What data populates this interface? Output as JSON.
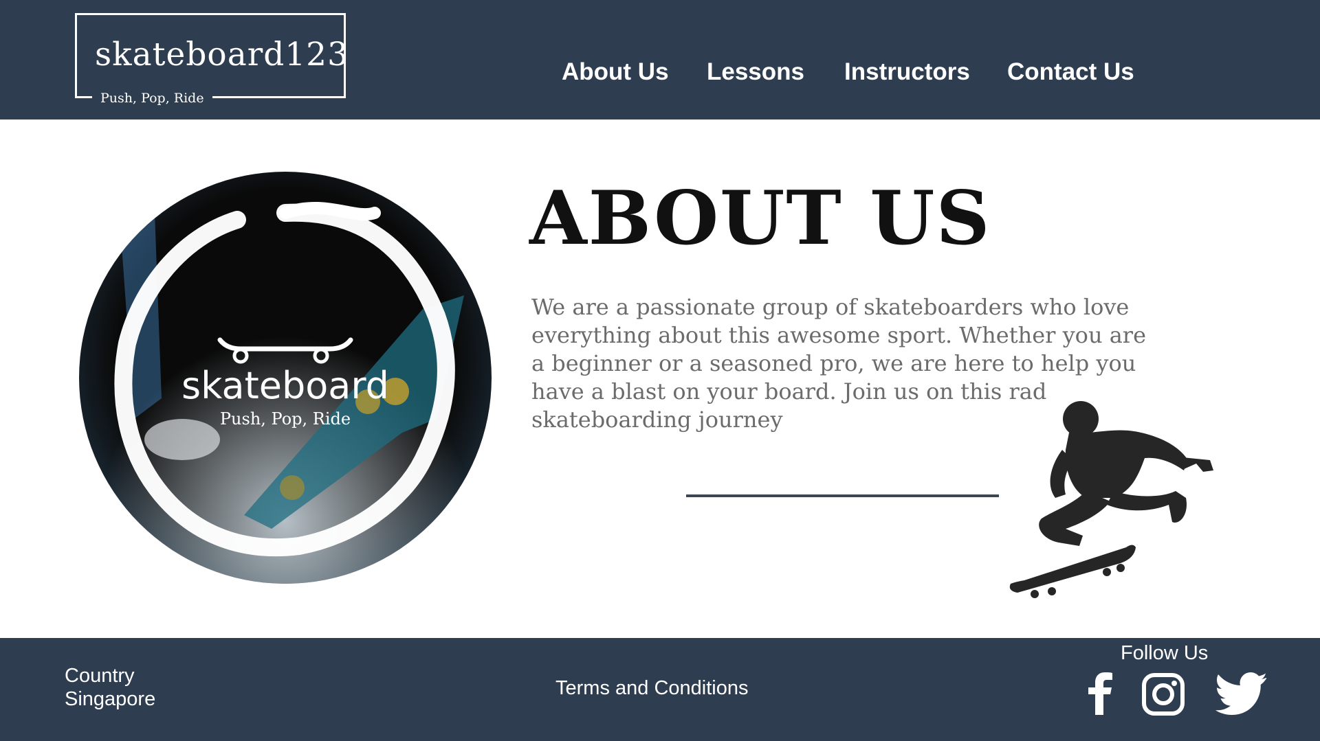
{
  "header": {
    "logo_title": "skateboard123",
    "logo_tagline": "Push, Pop, Ride",
    "nav": [
      "About Us",
      "Lessons",
      "Instructors",
      "Contact Us"
    ]
  },
  "hero": {
    "brand": "skateboard",
    "tagline": "Push, Pop, Ride"
  },
  "about": {
    "heading": "ABOUT US",
    "body": "We are a passionate group of skateboarders who love everything about this awesome sport. Whether you are a beginner or a seasoned pro, we are here to help you have a blast on your board. Join us on this rad skateboarding journey"
  },
  "footer": {
    "country_label": "Country",
    "country_value": "Singapore",
    "terms": "Terms and Conditions",
    "follow": "Follow Us",
    "social_icons": [
      "facebook-icon",
      "instagram-icon",
      "twitter-icon"
    ]
  },
  "colors": {
    "brand_navy": "#2e3e50",
    "text_gray": "#6b6b6b",
    "heading_black": "#111111"
  }
}
